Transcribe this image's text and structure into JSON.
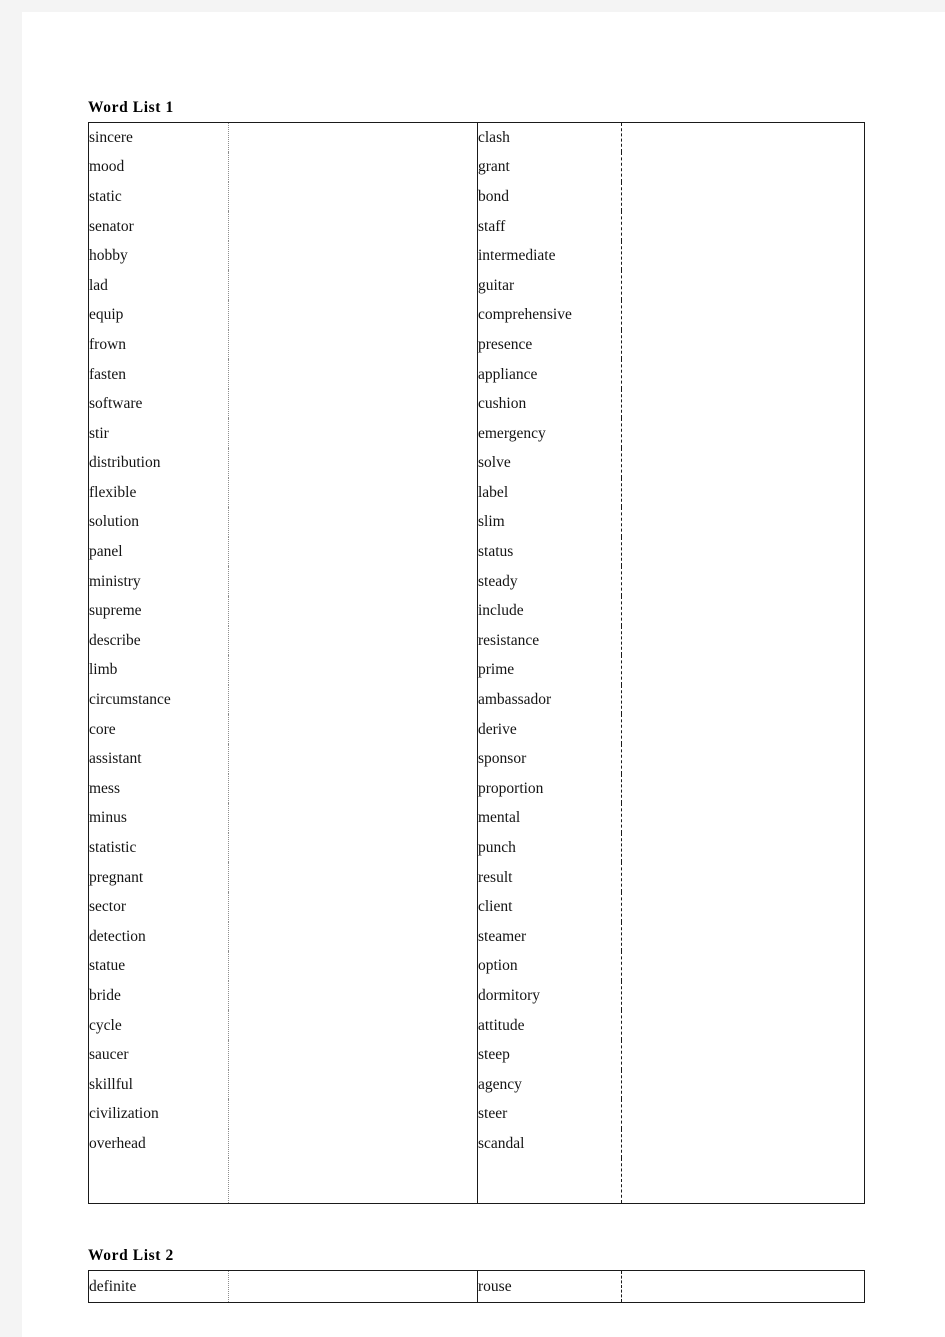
{
  "document": {
    "page_background": "#f4f4f4",
    "paper_color": "#ffffff",
    "text_color": "#141414"
  },
  "lists": [
    {
      "title": "Word List 1",
      "column_left": [
        "sincere",
        "mood",
        "static",
        "senator",
        "hobby",
        "lad",
        "equip",
        "frown",
        "fasten",
        "software",
        "stir",
        "distribution",
        "flexible",
        "solution",
        "panel",
        "ministry",
        "supreme",
        "describe",
        "limb",
        "circumstance",
        "core",
        "assistant",
        "mess",
        "minus",
        "statistic",
        "pregnant",
        "sector",
        "detection",
        "statue",
        "bride",
        "cycle",
        "saucer",
        "skillful",
        "civilization",
        "overhead"
      ],
      "column_right": [
        "clash",
        "grant",
        "bond",
        "staff",
        "intermediate",
        "guitar",
        "comprehensive",
        "presence",
        "appliance",
        "cushion",
        "emergency",
        "solve",
        "label",
        "slim",
        "status",
        "steady",
        "include",
        "resistance",
        "prime",
        "ambassador",
        "derive",
        "sponsor",
        "proportion",
        "mental",
        "punch",
        "result",
        "client",
        "steamer",
        "option",
        "dormitory",
        "attitude",
        "steep",
        "agency",
        "steer",
        "scandal"
      ],
      "has_trailing_blank_row": true
    },
    {
      "title": "Word List 2",
      "column_left": [
        "definite"
      ],
      "column_right": [
        "rouse"
      ],
      "has_trailing_blank_row": false
    }
  ]
}
